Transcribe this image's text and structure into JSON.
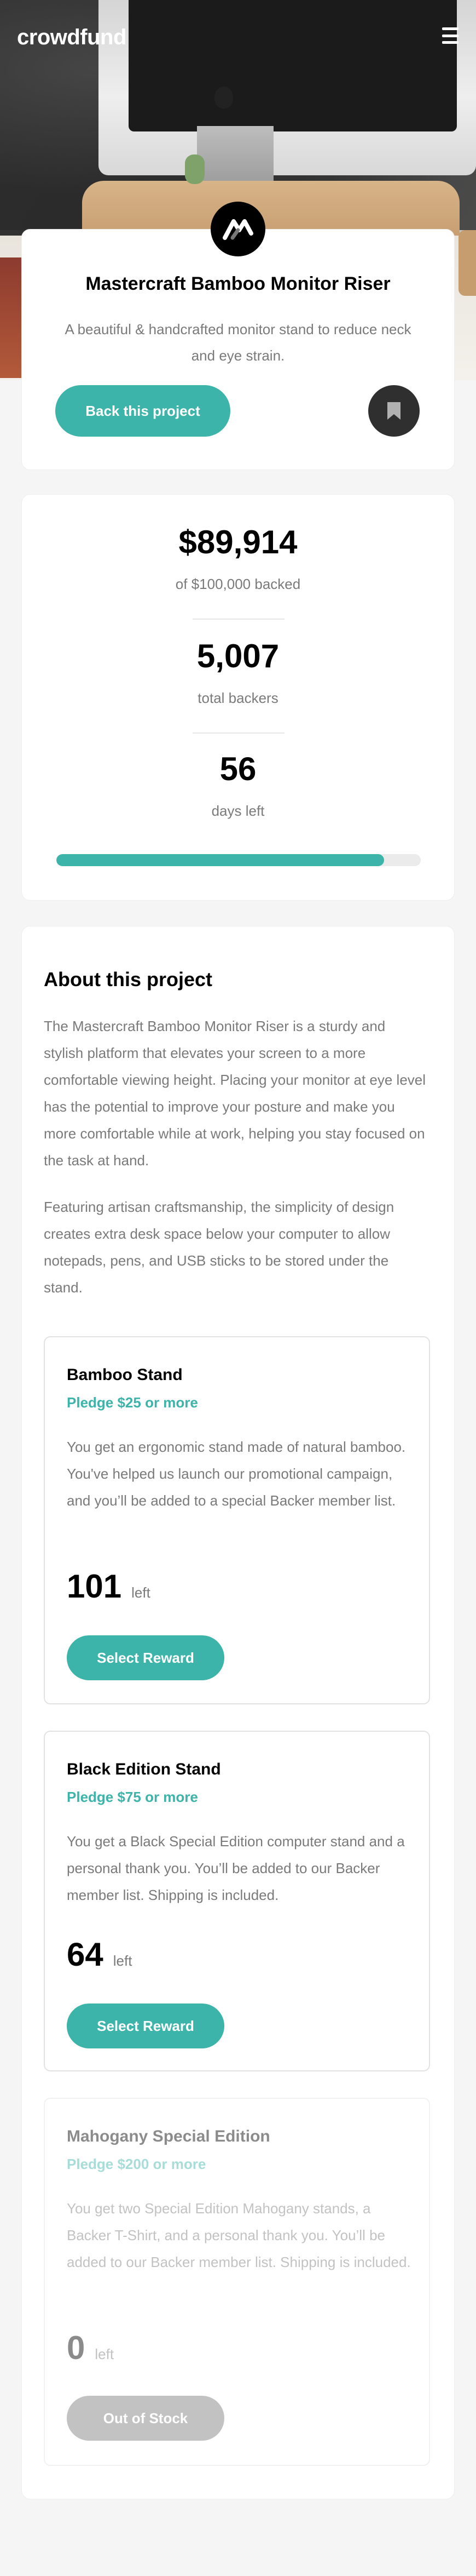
{
  "app": {
    "logo": "crowdfund"
  },
  "hero": {
    "title": "Mastercraft Bamboo Monitor Riser",
    "description": "A beautiful & handcrafted monitor stand to reduce neck and eye strain.",
    "back_button": "Back this project"
  },
  "stats": {
    "backed_amount": "$89,914",
    "backed_label": "of $100,000 backed",
    "backers_value": "5,007",
    "backers_label": "total backers",
    "days_value": "56",
    "days_label": "days left",
    "progress_fraction": 0.89914
  },
  "about": {
    "title": "About this project",
    "paragraph_1": "The Mastercraft Bamboo Monitor Riser is a sturdy and stylish platform that elevates your screen to a more comfortable viewing height. Placing your monitor at eye level has the potential to improve your posture and make you more comfortable while at work, helping you stay focused on the task at hand.",
    "paragraph_2": "Featuring artisan craftsmanship, the simplicity of design creates extra desk space below your computer to allow notepads, pens, and USB sticks to be stored under the stand."
  },
  "rewards": [
    {
      "title": "Bamboo Stand",
      "pledge": "Pledge $25 or more",
      "description": "You get an ergonomic stand made of natural bamboo. You've helped us launch our promotional campaign, and you’ll be added to a special Backer member list.",
      "count": "101",
      "left_label": "left",
      "button": "Select Reward"
    },
    {
      "title": "Black Edition Stand",
      "pledge": "Pledge $75 or more",
      "description": "You get a Black Special Edition computer stand and a personal thank you. You’ll be added to our Backer member list. Shipping is included.",
      "count": "64",
      "left_label": "left",
      "button": "Select Reward"
    },
    {
      "title": "Mahogany Special Edition",
      "pledge": "Pledge $200 or more",
      "description": "You get two Special Edition Mahogany stands, a Backer T-Shirt, and a personal thank you. You’ll be added to our Backer member list. Shipping is included.",
      "count": "0",
      "left_label": "left",
      "button": "Out of Stock"
    }
  ],
  "colors": {
    "accent": "#3cb4a9",
    "text_muted": "#7a7a7a",
    "dark": "#2f2f2f"
  }
}
